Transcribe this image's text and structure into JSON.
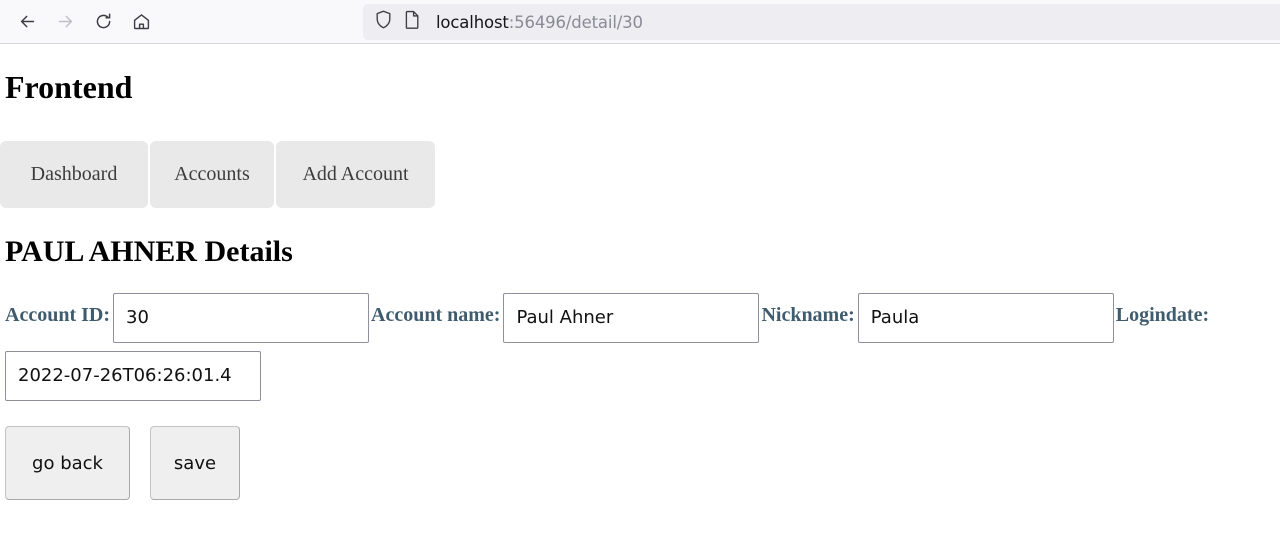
{
  "browser": {
    "nav": [
      {
        "name": "back-button",
        "icon": "arrow-left-icon",
        "enabled": true
      },
      {
        "name": "forward-button",
        "icon": "arrow-right-icon",
        "enabled": false
      },
      {
        "name": "reload-button",
        "icon": "reload-icon",
        "enabled": true
      },
      {
        "name": "home-button",
        "icon": "home-icon",
        "enabled": true
      }
    ],
    "urlbar": {
      "shield_icon": "shield-icon",
      "page_icon": "page-icon",
      "host": "localhost",
      "path": ":56496/detail/30",
      "full_url": "localhost:56496/detail/30"
    }
  },
  "page": {
    "title": "Frontend",
    "nav_tabs": [
      {
        "label": "Dashboard"
      },
      {
        "label": "Accounts"
      },
      {
        "label": "Add Account"
      }
    ],
    "detail_title": "PAUL AHNER Details",
    "fields": [
      {
        "label": "Account ID:",
        "value": "30",
        "name": "account-id"
      },
      {
        "label": "Account name:",
        "value": "Paul Ahner",
        "name": "account-name"
      },
      {
        "label": "Nickname:",
        "value": "Paula",
        "name": "nickname"
      },
      {
        "label": "Logindate:",
        "value": "2022-07-26T06:26:01.4",
        "name": "logindate"
      }
    ],
    "buttons": {
      "go_back": "go back",
      "save": "save"
    }
  },
  "colors": {
    "label": "#3f5c6e",
    "tab_bg": "#e9e9e9",
    "toolbar_bg": "#f9f9fb",
    "urlbar_bg": "#eeedf2"
  }
}
